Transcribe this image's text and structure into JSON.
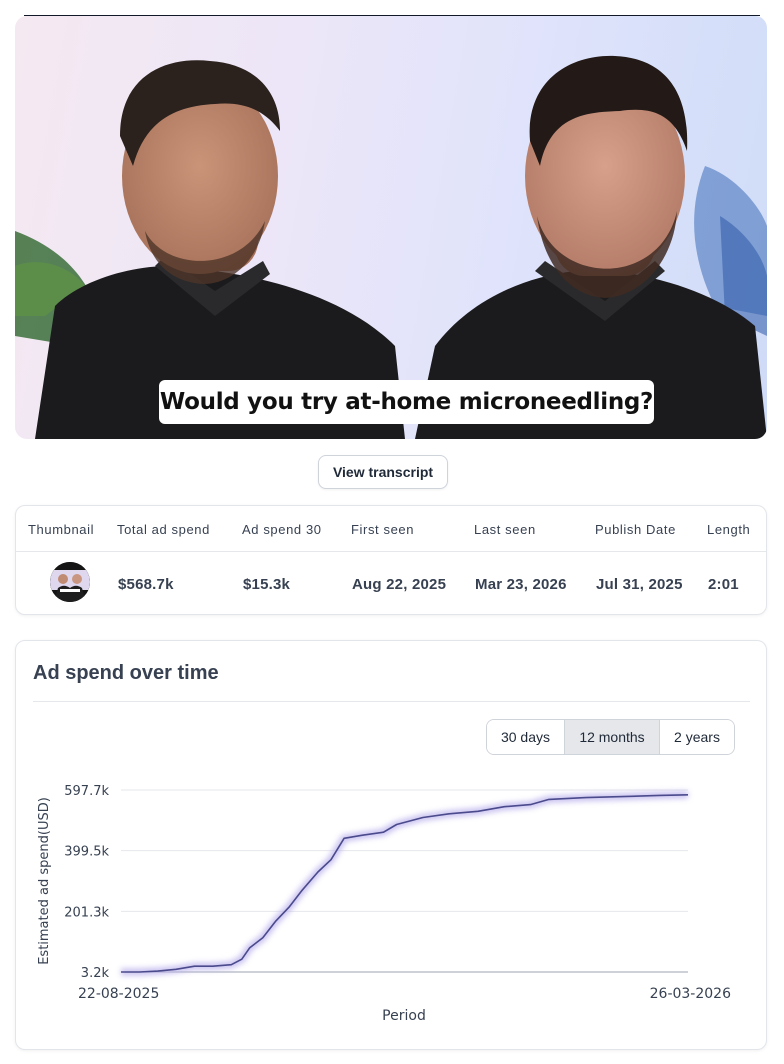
{
  "video": {
    "caption": "Would you try at-home microneedling?"
  },
  "transcript_button": "View transcript",
  "stats": {
    "headers": [
      "Thumbnail",
      "Total ad spend",
      "Ad spend 30",
      "First seen",
      "Last seen",
      "Publish Date",
      "Length"
    ],
    "values": {
      "total_ad_spend": "$568.7k",
      "ad_spend_30": "$15.3k",
      "first_seen": "Aug 22, 2025",
      "last_seen": "Mar 23, 2026",
      "publish_date": "Jul 31, 2025",
      "length": "2:01"
    }
  },
  "chart_card": {
    "title": "Ad spend over time",
    "ranges": [
      "30 days",
      "12 months",
      "2 years"
    ],
    "active_range": "12 months"
  },
  "colors": {
    "line": "#4a4a8c",
    "glow": "#b9b0ec",
    "active_range_bg": "#e5e7eb"
  },
  "chart_data": {
    "type": "line",
    "title": "",
    "xlabel": "Period",
    "ylabel": "Estimated ad spend(USD)",
    "x_tick_labels": [
      "22-08-2025",
      "26-03-2026"
    ],
    "y_tick_labels": [
      "3.2k",
      "201.3k",
      "399.5k",
      "597.7k"
    ],
    "y_ticks": [
      3.2,
      201.3,
      399.5,
      597.7
    ],
    "ylim": [
      3.2,
      597.7
    ],
    "xlim": [
      "2025-08-22",
      "2026-03-26"
    ],
    "grid": true,
    "legend": "none",
    "series": [
      {
        "values": [
          {
            "x": "2025-08-22",
            "y": 3.2
          },
          {
            "x": "2025-08-29",
            "y": 3.2
          },
          {
            "x": "2025-09-05",
            "y": 6
          },
          {
            "x": "2025-09-12",
            "y": 12
          },
          {
            "x": "2025-09-19",
            "y": 22
          },
          {
            "x": "2025-09-26",
            "y": 22
          },
          {
            "x": "2025-10-03",
            "y": 27
          },
          {
            "x": "2025-10-07",
            "y": 45
          },
          {
            "x": "2025-10-10",
            "y": 82
          },
          {
            "x": "2025-10-15",
            "y": 115
          },
          {
            "x": "2025-10-20",
            "y": 170
          },
          {
            "x": "2025-10-25",
            "y": 215
          },
          {
            "x": "2025-10-30",
            "y": 270
          },
          {
            "x": "2025-11-05",
            "y": 330
          },
          {
            "x": "2025-11-10",
            "y": 370
          },
          {
            "x": "2025-11-15",
            "y": 440
          },
          {
            "x": "2025-11-22",
            "y": 450
          },
          {
            "x": "2025-11-30",
            "y": 460
          },
          {
            "x": "2025-12-05",
            "y": 485
          },
          {
            "x": "2025-12-15",
            "y": 508
          },
          {
            "x": "2025-12-25",
            "y": 520
          },
          {
            "x": "2026-01-05",
            "y": 528
          },
          {
            "x": "2026-01-15",
            "y": 543
          },
          {
            "x": "2026-01-25",
            "y": 550
          },
          {
            "x": "2026-02-01",
            "y": 567
          },
          {
            "x": "2026-02-15",
            "y": 573
          },
          {
            "x": "2026-03-01",
            "y": 576
          },
          {
            "x": "2026-03-15",
            "y": 580
          },
          {
            "x": "2026-03-26",
            "y": 582
          }
        ]
      }
    ]
  }
}
